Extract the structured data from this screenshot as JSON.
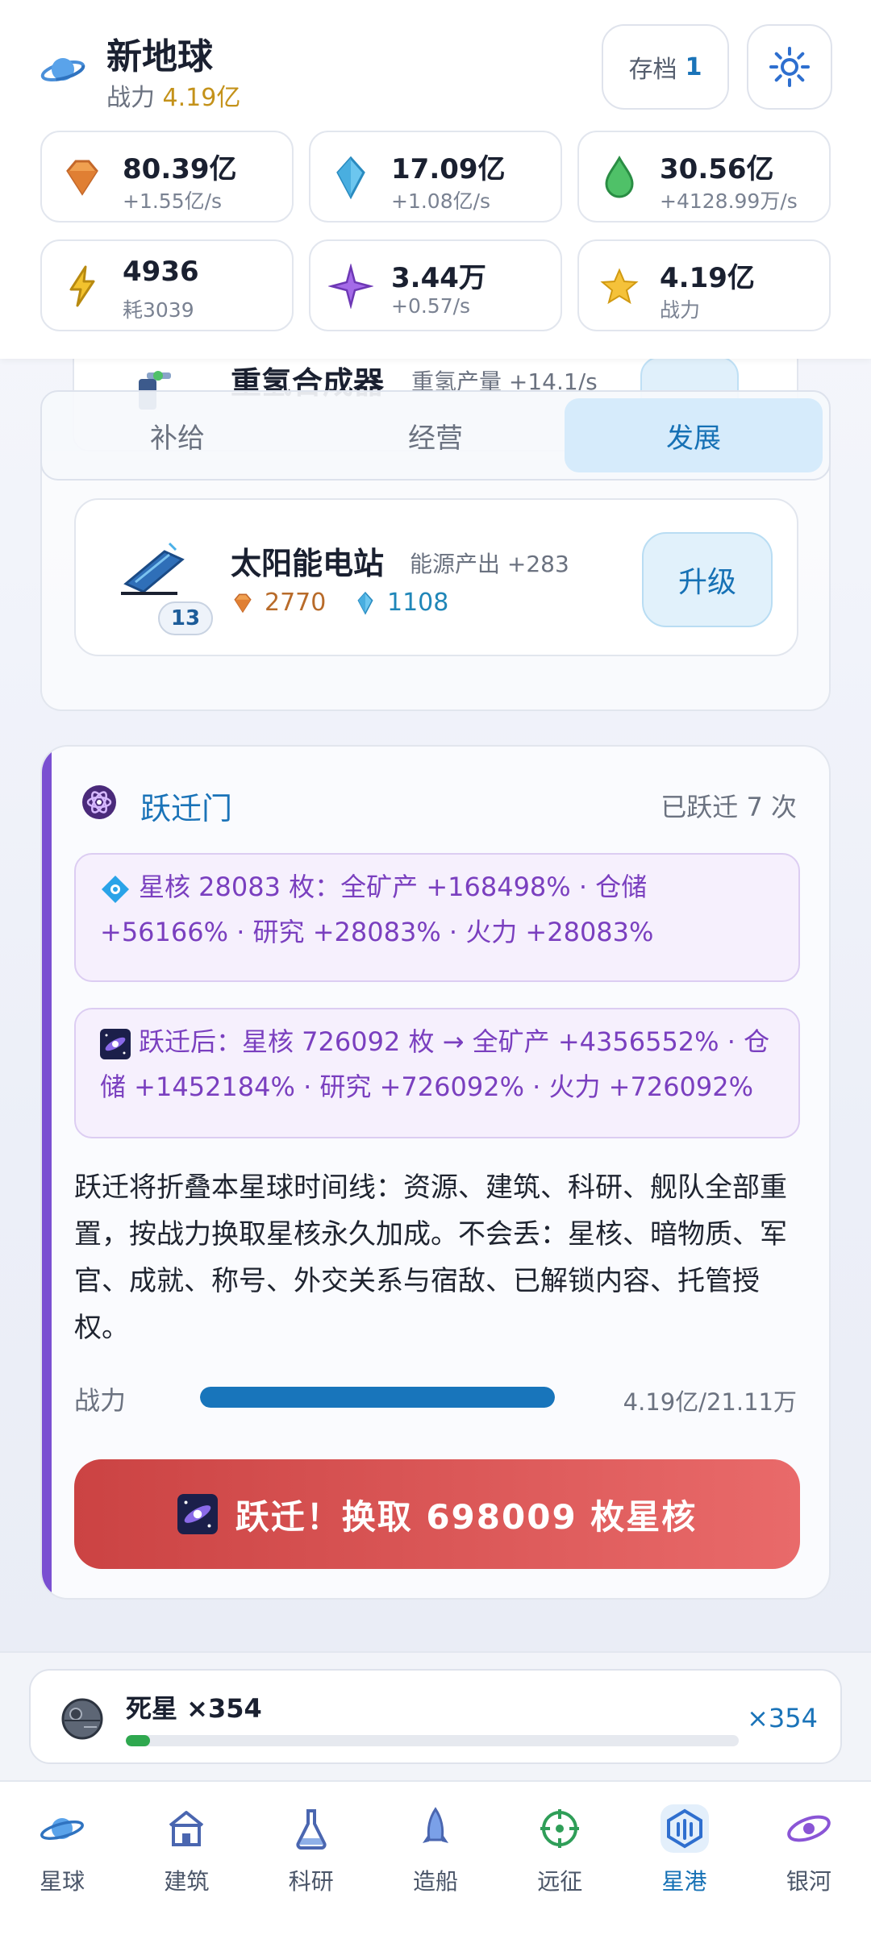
{
  "header": {
    "planet_name": "新地球",
    "power_label": "战力",
    "power_value": "4.19亿",
    "save_label": "存档",
    "save_num": "1"
  },
  "resources": [
    {
      "icon": "orange-gem-icon",
      "value": "80.39亿",
      "sub": "+1.55亿/s"
    },
    {
      "icon": "blue-crystal-icon",
      "value": "17.09亿",
      "sub": "+1.08亿/s"
    },
    {
      "icon": "green-drop-icon",
      "value": "30.56亿",
      "sub": "+4128.99万/s"
    },
    {
      "icon": "lightning-icon",
      "value": "4936",
      "sub": "耗3039"
    },
    {
      "icon": "purple-star-icon",
      "value": "3.44万",
      "sub": "+0.57/s"
    },
    {
      "icon": "gold-star-icon",
      "value": "4.19亿",
      "sub": "战力"
    }
  ],
  "partial_building": {
    "name": "重氢合成器",
    "desc": "重氢产量 +14.1/s"
  },
  "tabs": [
    {
      "label": "补给",
      "active": false
    },
    {
      "label": "经营",
      "active": false
    },
    {
      "label": "发展",
      "active": true
    }
  ],
  "building": {
    "name": "太阳能电站",
    "desc": "能源产出 +283",
    "level": "13",
    "cost_mineral": "2770",
    "cost_crystal": "1108",
    "upgrade_label": "升级"
  },
  "warp": {
    "title": "跃迁门",
    "count_text": "已跃迁 7 次",
    "current_bonus": "星核 28083 枚：全矿产 +168498% · 仓储 +56166% · 研究 +28083% · 火力 +28083%",
    "after_bonus": "跃迁后：星核 726092 枚 → 全矿产 +4356552% · 仓储 +1452184% · 研究 +726092% · 火力 +726092%",
    "description": "跃迁将折叠本星球时间线：资源、建筑、科研、舰队全部重置，按战力换取星核永久加成。不会丢：星核、暗物质、军官、成就、称号、外交关系与宿敌、已解锁内容、托管授权。",
    "power_label": "战力",
    "power_progress": "4.19亿/21.11万",
    "progress_fraction": 1.0,
    "button_label": "跃迁！换取 698009 枚星核"
  },
  "deathstar": {
    "name": "死星 ×354",
    "count": "×354",
    "progress_fraction": 0.04
  },
  "nav": [
    {
      "label": "星球",
      "icon": "planet-icon"
    },
    {
      "label": "建筑",
      "icon": "building-icon"
    },
    {
      "label": "科研",
      "icon": "flask-icon"
    },
    {
      "label": "造船",
      "icon": "rocket-icon"
    },
    {
      "label": "远征",
      "icon": "crosshair-icon"
    },
    {
      "label": "星港",
      "icon": "starport-icon",
      "active": true
    },
    {
      "label": "银河",
      "icon": "galaxy-icon"
    }
  ],
  "colors": {
    "accent": "#1671b5",
    "warp_purple": "#7a4fd1",
    "warp_button": "#d95454",
    "gold": "#c4921a"
  }
}
